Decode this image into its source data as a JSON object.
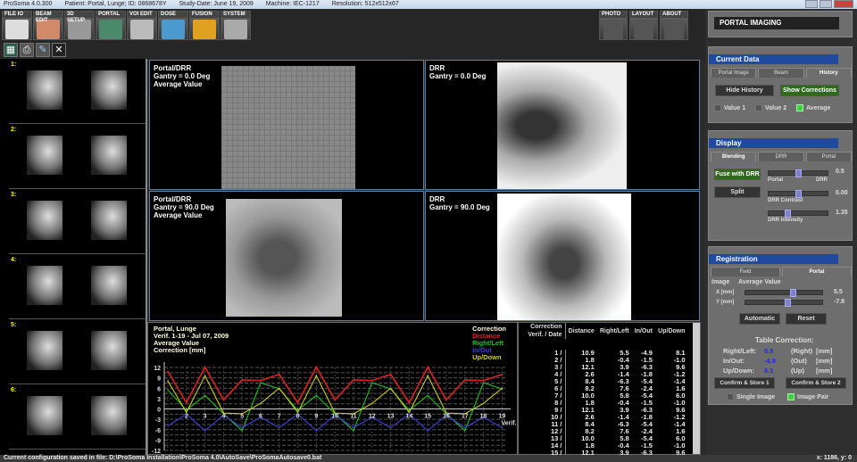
{
  "titlebar": {
    "app": "ProSoma 4.0.300",
    "patient": "Patient: Portal, Lunge; ID: 0868678Y",
    "study": "Study-Date: June 19, 2009",
    "machine": "Machine: IEC-1217",
    "resolution": "Resolution: 512x512x67"
  },
  "toolbar": [
    {
      "label": "FILE IO",
      "color": "#ddd"
    },
    {
      "label": "BEAM EDIT",
      "color": "#d08a6a"
    },
    {
      "label": "3D SETUP",
      "color": "#999"
    },
    {
      "label": "PORTAL",
      "color": "#4a8a6a"
    },
    {
      "label": "VOI EDIT",
      "color": "#bbb"
    },
    {
      "label": "DOSE",
      "color": "#4a9ad0"
    },
    {
      "label": "FUSION",
      "color": "#e0a020"
    },
    {
      "label": "SYSTEM",
      "color": "#aaa"
    }
  ],
  "toolbar_right": [
    {
      "label": "PHOTO"
    },
    {
      "label": "LAYOUT"
    },
    {
      "label": "ABOUT"
    }
  ],
  "thumbs": [
    "1:",
    "2:",
    "3:",
    "4:",
    "5:",
    "6:"
  ],
  "viewports": [
    {
      "l1": "Portal/DRR",
      "l2": "Gantry = 0.0 Deg",
      "l3": "Average Value"
    },
    {
      "l1": "DRR",
      "l2": "Gantry = 0.0 Deg",
      "l3": ""
    },
    {
      "l1": "Portal/DRR",
      "l2": "Gantry = 90.0 Deg",
      "l3": "Average Value"
    },
    {
      "l1": "DRR",
      "l2": "Gantry = 90.0 Deg",
      "l3": ""
    }
  ],
  "chart_data": {
    "type": "line",
    "title_lines": [
      "Portal, Lunge",
      "Verif. 1-19    - Jul 07, 2009",
      "Average Value",
      "Correction [mm]"
    ],
    "legend_title": "Correction",
    "xlabel": "Verif.",
    "ylim": [
      -12,
      12
    ],
    "yticks": [
      12,
      9,
      6,
      3,
      0,
      -3,
      -6,
      -9,
      -12
    ],
    "x": [
      1,
      2,
      3,
      4,
      5,
      6,
      7,
      8,
      9,
      10,
      11,
      12,
      13,
      14,
      15,
      16,
      17,
      18,
      19
    ],
    "series": [
      {
        "name": "Distance",
        "color": "#e02020",
        "values": [
          10.9,
          1.8,
          12.1,
          2.6,
          8.4,
          8.2,
          10.0,
          1.8,
          12.1,
          2.6,
          8.4,
          8.2,
          10.0,
          1.8,
          12.1,
          2.6,
          8.4,
          8.2,
          10.0
        ]
      },
      {
        "name": "Right/Left",
        "color": "#20c020",
        "values": [
          5.5,
          -0.4,
          3.9,
          -1.4,
          -6.3,
          7.6,
          5.8,
          -0.4,
          3.9,
          -1.4,
          -6.3,
          7.6,
          5.8,
          -0.4,
          3.9,
          -1.4,
          -6.3,
          7.6,
          5.8
        ]
      },
      {
        "name": "In/Out",
        "color": "#4040e0",
        "values": [
          -4.9,
          -1.5,
          -6.3,
          -1.8,
          -5.4,
          -2.4,
          -5.4,
          -1.5,
          -6.3,
          -1.8,
          -5.4,
          -2.4,
          -5.4,
          -1.5,
          -6.3,
          -1.8,
          -5.4,
          -2.4,
          -5.4
        ]
      },
      {
        "name": "Up/Down",
        "color": "#d0d020",
        "values": [
          8.1,
          -1.0,
          9.6,
          -1.2,
          -1.4,
          1.6,
          6.0,
          -1.0,
          9.6,
          -1.2,
          -1.4,
          1.6,
          6.0,
          -1.0,
          9.6,
          -1.2,
          -1.4,
          1.6,
          6.0
        ]
      }
    ]
  },
  "table": {
    "headers": [
      "Correction Verif. / Date",
      "Distance",
      "Right/Left",
      "In/Out",
      "Up/Down"
    ],
    "rows": [
      [
        "1 /",
        "10.9",
        "5.5",
        "-4.9",
        "8.1"
      ],
      [
        "2 /",
        "1.8",
        "-0.4",
        "-1.5",
        "-1.0"
      ],
      [
        "3 /",
        "12.1",
        "3.9",
        "-6.3",
        "9.6"
      ],
      [
        "4 /",
        "2.6",
        "-1.4",
        "-1.8",
        "-1.2"
      ],
      [
        "5 /",
        "8.4",
        "-6.3",
        "-5.4",
        "-1.4"
      ],
      [
        "6 /",
        "8.2",
        "7.6",
        "-2.4",
        "1.6"
      ],
      [
        "7 /",
        "10.0",
        "5.8",
        "-5.4",
        "6.0"
      ],
      [
        "8 /",
        "1.8",
        "-0.4",
        "-1.5",
        "-1.0"
      ],
      [
        "9 /",
        "12.1",
        "3.9",
        "-6.3",
        "9.6"
      ],
      [
        "10 /",
        "2.6",
        "-1.4",
        "-1.8",
        "-1.2"
      ],
      [
        "11 /",
        "8.4",
        "-6.3",
        "-5.4",
        "-1.4"
      ],
      [
        "12 /",
        "8.2",
        "7.6",
        "-2.4",
        "1.6"
      ],
      [
        "13 /",
        "10.0",
        "5.8",
        "-5.4",
        "6.0"
      ],
      [
        "14 /",
        "1.8",
        "-0.4",
        "-1.5",
        "-1.0"
      ],
      [
        "15 /",
        "12.1",
        "3.9",
        "-6.3",
        "9.6"
      ]
    ]
  },
  "status": {
    "message": "Current configuration saved in file: D:\\ProSoma Installation\\ProSoma 4.0\\AutoSave\\ProSomaAutosave0.bat",
    "coords": "x: 1186, y: 0"
  },
  "right": {
    "module_title": "PORTAL IMAGING",
    "current": {
      "title": "Current Data",
      "tabs": [
        "Portal Image",
        "Beam",
        "History"
      ],
      "hide": "Hide History",
      "show": "Show Corrections",
      "v1": "Value 1",
      "v2": "Value 2",
      "avg": "Average"
    },
    "display": {
      "title": "Display",
      "tabs": [
        "Blending",
        "DRR",
        "Portal"
      ],
      "fuse": "Fuse with DRR",
      "split": "Split",
      "s1l": "Portal",
      "s1r": "DRR",
      "s1v": "0.5",
      "s2l": "DRR Contrast",
      "s2v": "0.00",
      "s3l": "DRR Intensity",
      "s3v": "1.35",
      "s1": 0.5,
      "s2": 0.5,
      "s3": 0.3
    },
    "registration": {
      "title": "Registration",
      "tabs": [
        "Field",
        "Portal"
      ],
      "image": "Image",
      "avg": "Average Value",
      "x": "X [mm]",
      "xv": "5.5",
      "y": "Y [mm]",
      "yv": "-7.8",
      "xs": 0.62,
      "ys": 0.55,
      "auto": "Automatic",
      "reset": "Reset",
      "tc": "Table Correction:",
      "rows": [
        [
          "Right/Left:",
          "5.5",
          "(Right)",
          "[mm]"
        ],
        [
          "In/Out:",
          "-4.9",
          "(Out)",
          "[mm]"
        ],
        [
          "Up/Down:",
          "8.1",
          "(Up)",
          "[mm]"
        ]
      ],
      "c1": "Confirm & Store 1",
      "c2": "Confirm & Store 2",
      "single": "Single Image",
      "pair": "Image Pair"
    }
  }
}
